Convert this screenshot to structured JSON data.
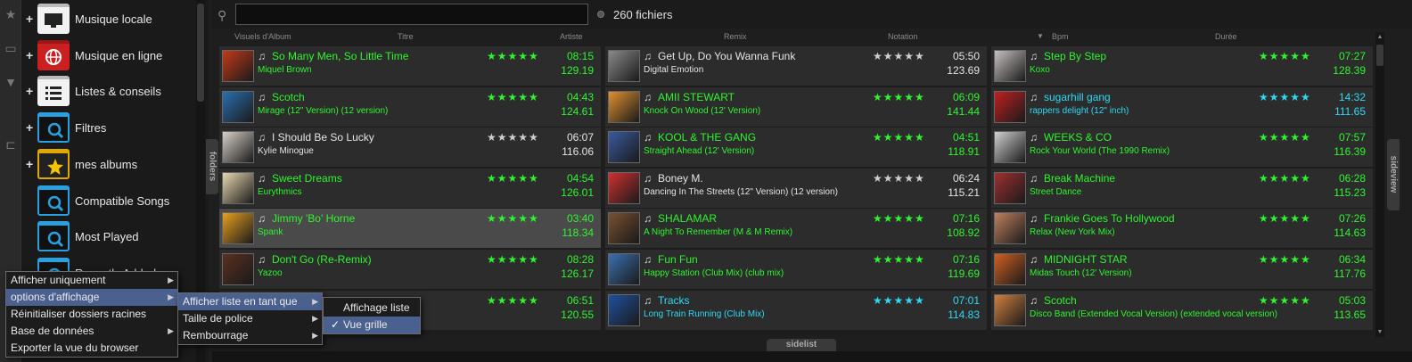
{
  "search": {
    "value": "",
    "placeholder": ""
  },
  "file_count": "260 fichiers",
  "folders": [
    {
      "label": "Musique locale",
      "expandable": true,
      "icon": "monitor-icon"
    },
    {
      "label": "Musique en ligne",
      "expandable": true,
      "icon": "globe-icon"
    },
    {
      "label": "Listes & conseils",
      "expandable": true,
      "icon": "list-icon"
    },
    {
      "label": "Filtres",
      "expandable": true,
      "icon": "filter-folder-icon"
    },
    {
      "label": "mes albums",
      "expandable": true,
      "icon": "star-folder-icon"
    },
    {
      "label": "Compatible Songs",
      "expandable": false,
      "icon": "filter-folder-icon"
    },
    {
      "label": "Most Played",
      "expandable": false,
      "icon": "filter-folder-icon"
    },
    {
      "label": "Recently Added",
      "expandable": false,
      "icon": "filter-folder-icon"
    }
  ],
  "columns": [
    "Visuels d'Album",
    "Titre",
    "Artiste",
    "Remix",
    "Notation",
    "Bpm",
    "Durée"
  ],
  "sort_indicator": "▼",
  "tabs": {
    "folders": "folders",
    "sideview": "sideview",
    "sidelist": "sidelist"
  },
  "tracks": [
    [
      {
        "title": "So Many Men, So Little Time",
        "artist": "Miquel Brown",
        "time": "08:15",
        "bpm": "129.19",
        "rating": 5,
        "color": "green"
      },
      {
        "title": "Scotch",
        "artist": "Mirage (12\" Version) (12 version)",
        "time": "04:43",
        "bpm": "124.61",
        "rating": 5,
        "color": "green"
      },
      {
        "title": "I Should Be So Lucky",
        "artist": "Kylie Minogue",
        "time": "06:07",
        "bpm": "116.06",
        "rating": 5,
        "color": "white"
      },
      {
        "title": "Sweet Dreams",
        "artist": "Eurythmics",
        "time": "04:54",
        "bpm": "126.01",
        "rating": 5,
        "color": "green"
      },
      {
        "title": "Jimmy 'Bo' Horne",
        "artist": "Spank",
        "time": "03:40",
        "bpm": "118.34",
        "rating": 5,
        "color": "green",
        "highlight": true
      },
      {
        "title": "Don't Go (Re-Remix)",
        "artist": "Yazoo",
        "time": "08:28",
        "bpm": "126.17",
        "rating": 5,
        "color": "green"
      },
      {
        "title": "",
        "artist": "",
        "time": "06:51",
        "bpm": "120.55",
        "rating": 5,
        "color": "green"
      }
    ],
    [
      {
        "title": "Get Up, Do You Wanna Funk",
        "artist": "Digital Emotion",
        "time": "05:50",
        "bpm": "123.69",
        "rating": 5,
        "color": "white"
      },
      {
        "title": "AMII STEWART",
        "artist": "Knock On Wood (12' Version)",
        "time": "06:09",
        "bpm": "141.44",
        "rating": 5,
        "color": "green"
      },
      {
        "title": "KOOL & THE GANG",
        "artist": "Straight Ahead (12' Version)",
        "time": "04:51",
        "bpm": "118.91",
        "rating": 5,
        "color": "green"
      },
      {
        "title": "Boney M.",
        "artist": "Dancing In The Streets (12\" Version) (12 version)",
        "time": "06:24",
        "bpm": "115.21",
        "rating": 5,
        "color": "white"
      },
      {
        "title": "SHALAMAR",
        "artist": "A Night To Remember (M & M Remix)",
        "time": "07:16",
        "bpm": "108.92",
        "rating": 5,
        "color": "green"
      },
      {
        "title": "Fun Fun",
        "artist": "Happy Station (Club Mix) (club mix)",
        "time": "07:16",
        "bpm": "119.69",
        "rating": 5,
        "color": "green"
      },
      {
        "title": "Tracks",
        "artist": "Long Train Running (Club Mix)",
        "time": "07:01",
        "bpm": "114.83",
        "rating": 5,
        "color": "cyan"
      }
    ],
    [
      {
        "title": "Step By Step",
        "artist": "Koxo",
        "time": "07:27",
        "bpm": "128.39",
        "rating": 5,
        "color": "green"
      },
      {
        "title": "sugarhill gang",
        "artist": "rappers delight (12\" inch)",
        "time": "14:32",
        "bpm": "111.65",
        "rating": 5,
        "color": "cyan"
      },
      {
        "title": "WEEKS & CO",
        "artist": "Rock Your World (The 1990 Remix)",
        "time": "07:57",
        "bpm": "116.39",
        "rating": 5,
        "color": "green"
      },
      {
        "title": "Break Machine",
        "artist": "Street Dance",
        "time": "06:28",
        "bpm": "115.23",
        "rating": 5,
        "color": "green"
      },
      {
        "title": "Frankie Goes To Hollywood",
        "artist": "Relax (New York Mix)",
        "time": "07:26",
        "bpm": "114.63",
        "rating": 5,
        "color": "green"
      },
      {
        "title": "MIDNIGHT STAR",
        "artist": "Midas Touch (12' Version)",
        "time": "06:34",
        "bpm": "117.76",
        "rating": 5,
        "color": "green"
      },
      {
        "title": "Scotch",
        "artist": "Disco Band (Extended Vocal Version) (extended vocal version)",
        "time": "05:03",
        "bpm": "113.65",
        "rating": 5,
        "color": "green"
      }
    ]
  ],
  "context_menu": {
    "main": [
      {
        "label": "Afficher uniquement",
        "submenu": true,
        "selected": false
      },
      {
        "label": "options d'affichage",
        "submenu": true,
        "selected": true
      },
      {
        "label": "Réinitialiser dossiers racines",
        "submenu": false,
        "selected": false
      },
      {
        "label": "Base de données",
        "submenu": true,
        "selected": false
      },
      {
        "label": "Exporter la vue du browser",
        "submenu": false,
        "selected": false
      }
    ],
    "sub1": [
      {
        "label": "Afficher liste en tant que",
        "submenu": true,
        "selected": true
      },
      {
        "label": "Taille de police",
        "submenu": true,
        "selected": false
      },
      {
        "label": "Rembourrage",
        "submenu": true,
        "selected": false
      }
    ],
    "sub2": [
      {
        "label": "Affichage liste",
        "checked": false,
        "selected": false
      },
      {
        "label": "Vue grille",
        "checked": true,
        "selected": true
      }
    ]
  },
  "colors": {
    "green": "#2ef52e",
    "cyan": "#2ed8f5",
    "white": "#e4e4e4",
    "menu_selected": "#4a6190",
    "cell_bg": "#2c2c2c",
    "highlight_bg": "#4a4a4a"
  }
}
